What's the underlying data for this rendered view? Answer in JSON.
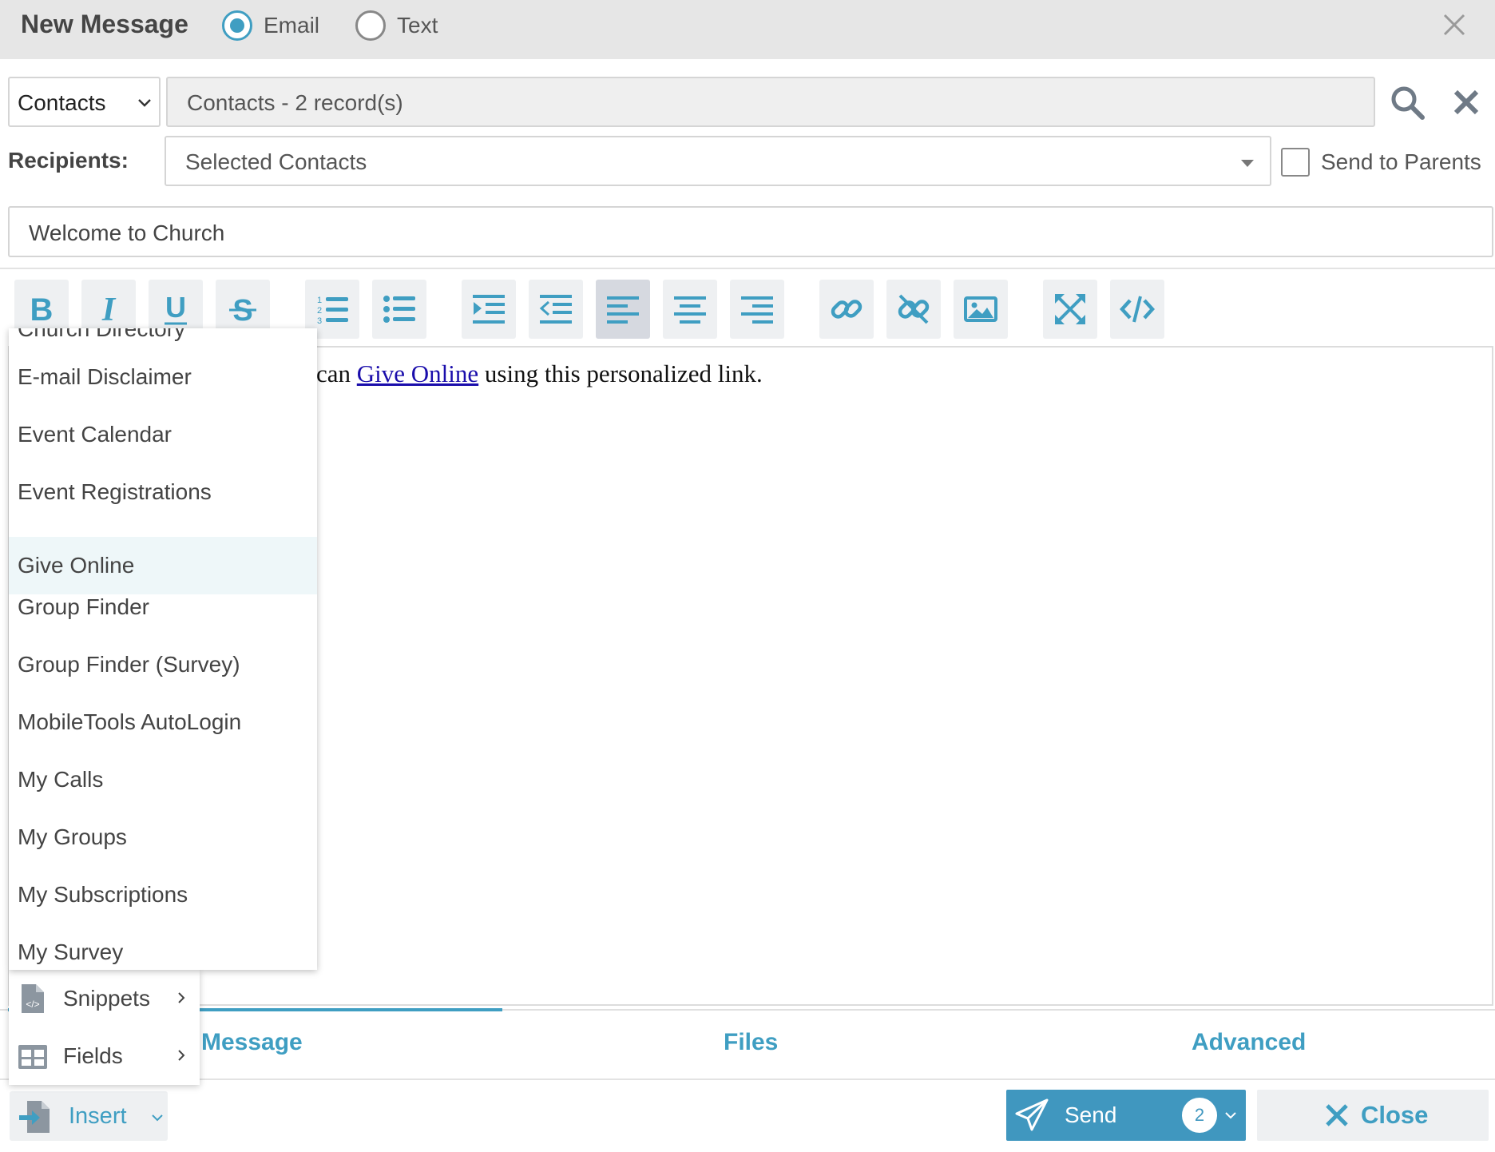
{
  "header": {
    "title": "New Message",
    "mode_options": [
      {
        "label": "Email",
        "selected": true
      },
      {
        "label": "Text",
        "selected": false
      }
    ],
    "close_icon": "close-x-icon"
  },
  "source": {
    "type_value": "Contacts",
    "records_value": "Contacts - 2 record(s)"
  },
  "recipients": {
    "label": "Recipients:",
    "value": "Selected Contacts",
    "send_to_parents_label": "Send to Parents",
    "send_to_parents_checked": false
  },
  "subject": {
    "value": "Welcome to Church"
  },
  "toolbar": {
    "buttons": [
      "bold-icon",
      "italic-icon",
      "underline-icon",
      "strikethrough-icon",
      "ordered-list-icon",
      "unordered-list-icon",
      "indent-icon",
      "outdent-icon",
      "align-left-icon",
      "align-center-icon",
      "align-right-icon",
      "link-icon",
      "unlink-icon",
      "image-icon",
      "fullscreen-icon",
      "code-view-icon"
    ],
    "active": "align-left-icon"
  },
  "editor": {
    "before_text": "can ",
    "link_text": "Give Online",
    "after_text": " using this personalized link."
  },
  "dropdown": {
    "items": [
      "Church Directory",
      "E-mail Disclaimer",
      "Event Calendar",
      "Event Registrations",
      "Give Online",
      "Group Finder",
      "Group Finder (Survey)",
      "MobileTools AutoLogin",
      "My Calls",
      "My Groups",
      "My Subscriptions",
      "My Survey"
    ],
    "highlighted": "Give Online"
  },
  "insert_menu": {
    "items": [
      {
        "label": "Snippets",
        "icon": "snippet-file-icon"
      },
      {
        "label": "Fields",
        "icon": "fields-table-icon"
      }
    ]
  },
  "tabs": [
    {
      "label": "Message",
      "active": true
    },
    {
      "label": "Files",
      "active": false
    },
    {
      "label": "Advanced",
      "active": false
    }
  ],
  "footer": {
    "insert_label": "Insert",
    "send_label": "Send",
    "send_count": "2",
    "close_label": "Close"
  },
  "colors": {
    "accent": "#3f9ec2",
    "send_button": "#4097bf",
    "title_bar": "#e6e6e6",
    "link": "#1a0dab"
  }
}
